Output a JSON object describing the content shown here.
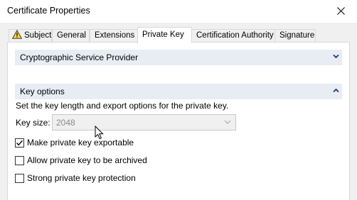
{
  "window": {
    "title": "Certificate Properties"
  },
  "tabs": [
    {
      "label": "Subject",
      "warning": true
    },
    {
      "label": "General"
    },
    {
      "label": "Extensions"
    },
    {
      "label": "Private Key",
      "selected": true
    },
    {
      "label": "Certification Authority"
    },
    {
      "label": "Signature"
    }
  ],
  "sections": {
    "csp": {
      "title": "Cryptographic Service Provider",
      "expanded": false
    },
    "key_options": {
      "title": "Key options",
      "expanded": true
    }
  },
  "key_options": {
    "description": "Set the key length and export options for the private key.",
    "key_size_label": "Key size:",
    "key_size_value": "2048",
    "key_size_disabled": true
  },
  "checkboxes": [
    {
      "label": "Make private key exportable",
      "checked": true
    },
    {
      "label": "Allow private key to be archived",
      "checked": false
    },
    {
      "label": "Strong private key protection",
      "checked": false
    }
  ],
  "colors": {
    "section_header_bg": "#e8edf4",
    "dialog_bg": "#f0f0f0",
    "chevron": "#1c3b66"
  }
}
